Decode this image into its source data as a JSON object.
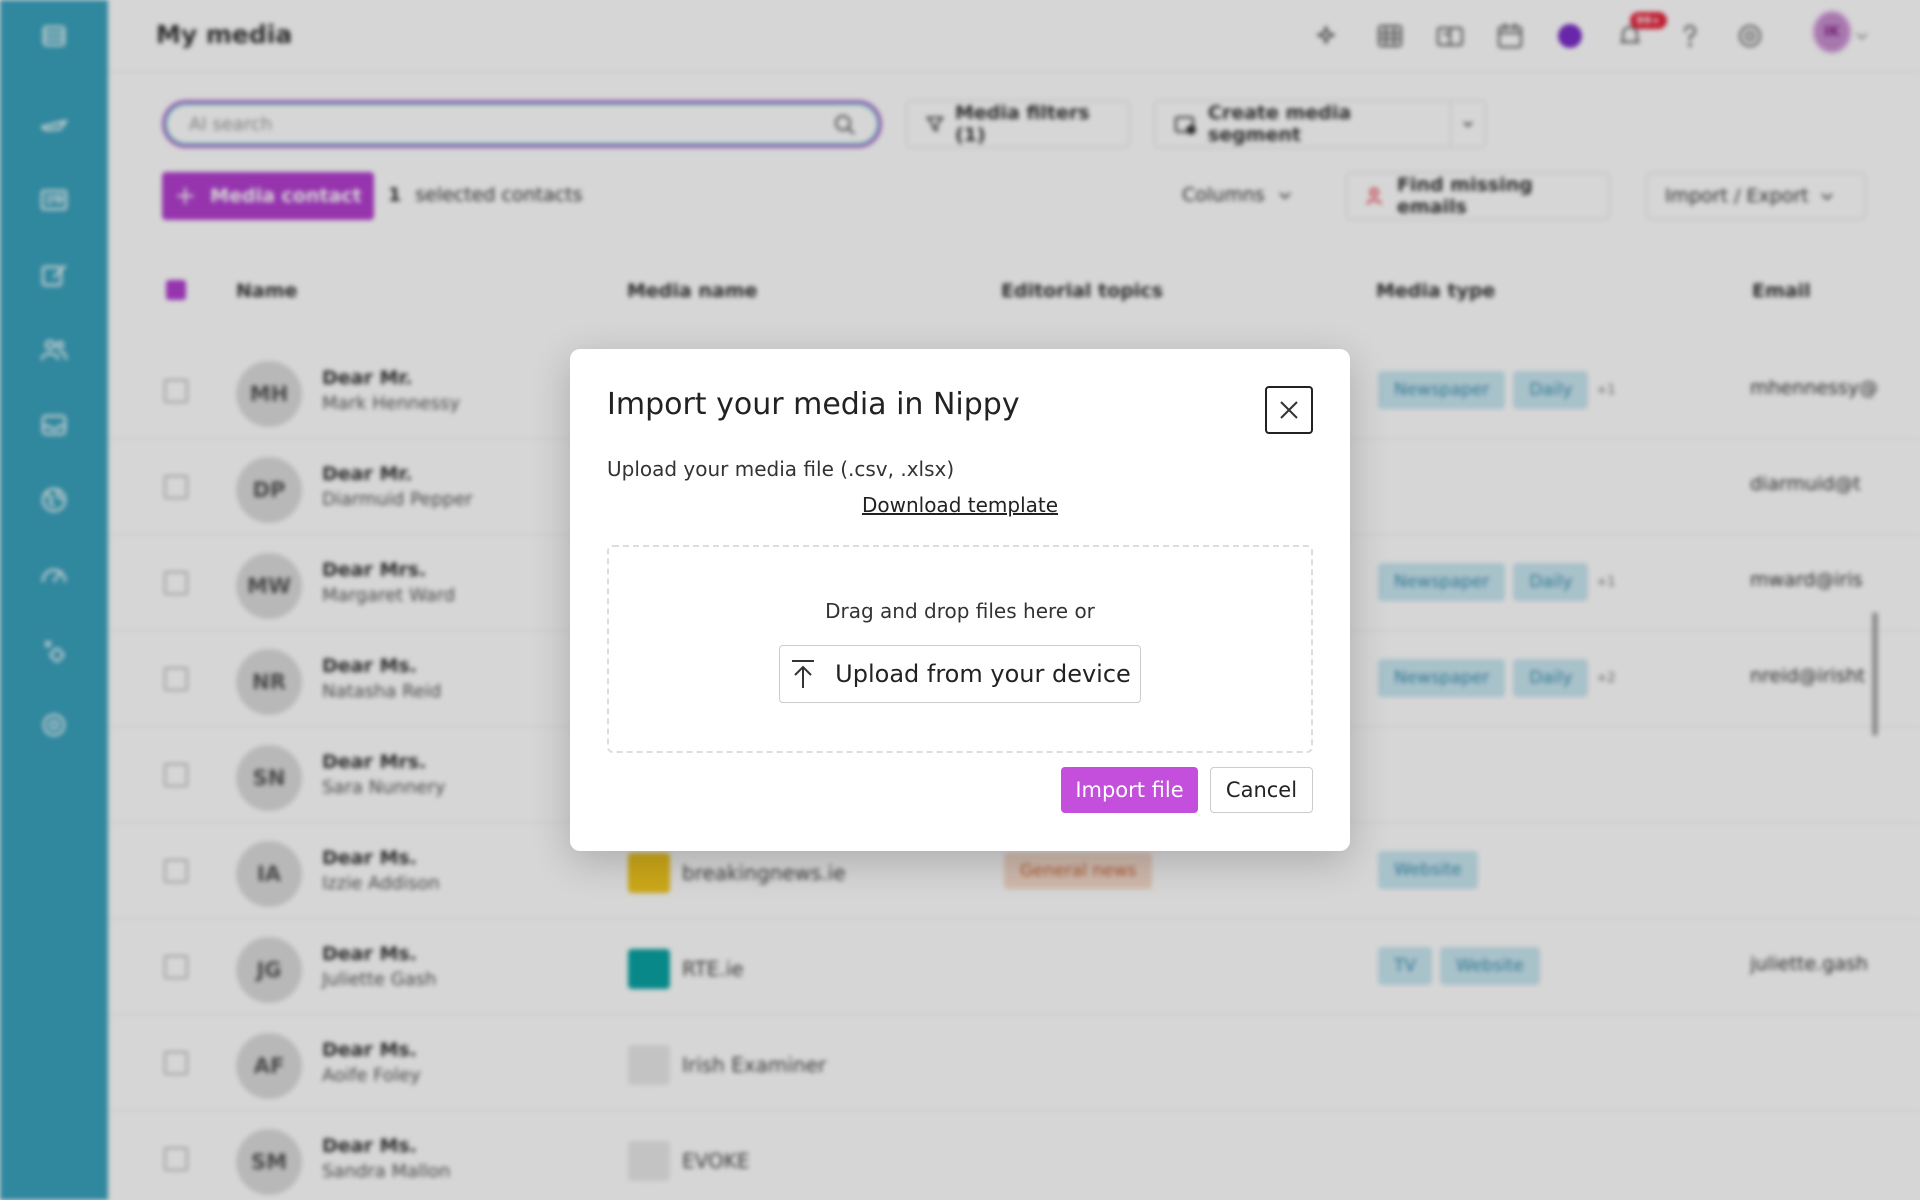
{
  "header": {
    "title": "My media",
    "notification_badge": "99+",
    "user_initials": "IK"
  },
  "toolbar": {
    "search_placeholder": "AI search",
    "filters_label": "Media filters (1)",
    "segment_label": "Create media segment",
    "add_contact_label": "Media contact",
    "selected_count": "1",
    "selected_label": "selected contacts",
    "columns_label": "Columns",
    "find_emails_label": "Find missing emails",
    "import_export_label": "Import / Export"
  },
  "table": {
    "columns": [
      "Name",
      "Media name",
      "Editorial topics",
      "Media type",
      "Email"
    ],
    "rows": [
      {
        "initials": "MH",
        "title": "Dear Mr.",
        "name": "Mark Hennessy",
        "media": "",
        "topic": "",
        "types": [
          "Newspaper",
          "Daily"
        ],
        "more": "+1",
        "email": "mhennessy@"
      },
      {
        "initials": "DP",
        "title": "Dear Mr.",
        "name": "Diarmuid Pepper",
        "media": "",
        "topic": "",
        "types": [],
        "more": "",
        "email": "diarmuid@t"
      },
      {
        "initials": "MW",
        "title": "Dear Mrs.",
        "name": "Margaret Ward",
        "media": "",
        "topic": "",
        "types": [
          "Newspaper",
          "Daily"
        ],
        "more": "+1",
        "email": "mward@iris"
      },
      {
        "initials": "NR",
        "title": "Dear Ms.",
        "name": "Natasha Reid",
        "media": "",
        "topic": "",
        "types": [
          "Newspaper",
          "Daily"
        ],
        "more": "+2",
        "email": "nreid@irisht"
      },
      {
        "initials": "SN",
        "title": "Dear Mrs.",
        "name": "Sara Nunnery",
        "media": "",
        "topic": "",
        "types": [],
        "more": "",
        "email": ""
      },
      {
        "initials": "IA",
        "title": "Dear Ms.",
        "name": "Izzie Addison",
        "media": "breakingnews.ie",
        "topic": "General news",
        "types": [
          "Website"
        ],
        "more": "",
        "email": ""
      },
      {
        "initials": "JG",
        "title": "Dear Ms.",
        "name": "Juliette Gash",
        "media": "RTE.ie",
        "topic": "",
        "types": [
          "TV",
          "Website"
        ],
        "more": "",
        "email": "juliette.gash"
      },
      {
        "initials": "AF",
        "title": "Dear Ms.",
        "name": "Aoife Foley",
        "media": "Irish Examiner",
        "topic": "",
        "types": [],
        "more": "",
        "email": ""
      },
      {
        "initials": "SM",
        "title": "Dear Ms.",
        "name": "Sandra Mallon",
        "media": "EVOKE",
        "topic": "",
        "types": [],
        "more": "",
        "email": ""
      }
    ]
  },
  "modal": {
    "title": "Import your media in Nippy",
    "subtitle": "Upload your media file (.csv, .xlsx)",
    "download_link": "Download template",
    "drop_text": "Drag and drop files here or",
    "upload_label": "Upload from your device",
    "import_label": "Import file",
    "cancel_label": "Cancel"
  },
  "colors": {
    "sidebar": "#3aa2bd",
    "accent": "#b33fd0",
    "import_button": "#c44fdd"
  }
}
